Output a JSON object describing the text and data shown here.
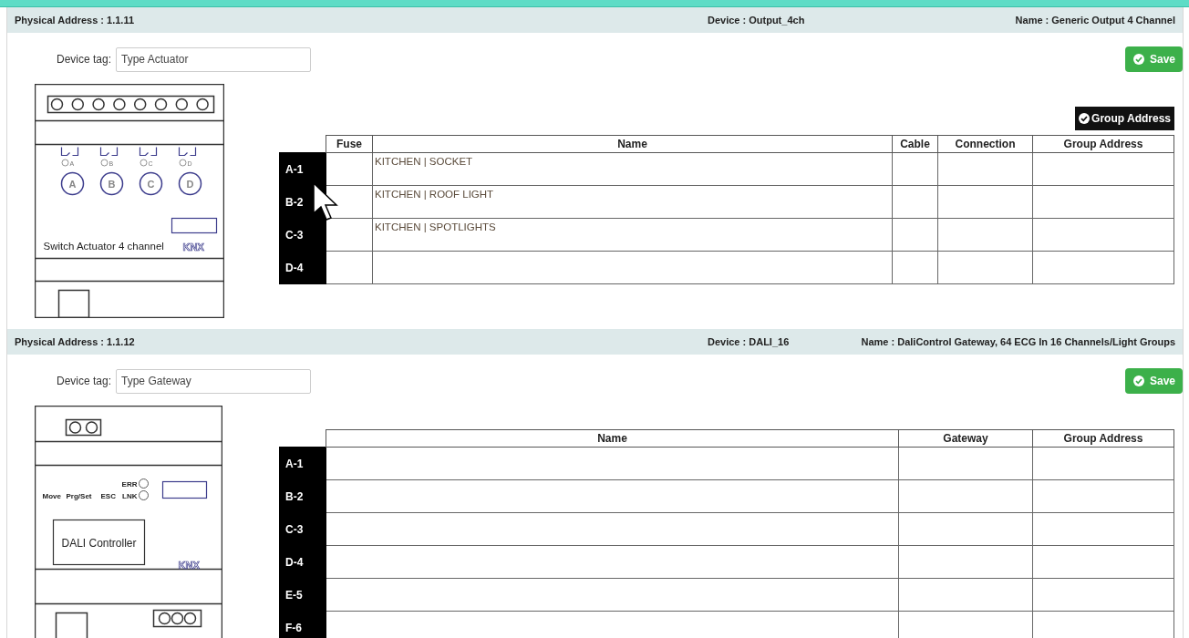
{
  "devices": [
    {
      "physical_address": "Physical Address : 1.1.11",
      "device": "Device : Output_4ch",
      "name": "Name : Generic Output 4 Channel",
      "tag_label": "Device tag:",
      "tag_value": "Type Actuator",
      "save": "Save",
      "group_address_button": "Group Address",
      "drawing": {
        "kind": "actuator",
        "channels": [
          {
            "led": "A",
            "button": "A"
          },
          {
            "led": "B",
            "button": "B"
          },
          {
            "led": "C",
            "button": "C"
          },
          {
            "led": "D",
            "button": "D"
          }
        ],
        "label": "Switch Actuator 4 channel",
        "logo": "KNX"
      },
      "table": {
        "columns": [
          {
            "title": "Fuse",
            "kind": "fuse"
          },
          {
            "title": "Name",
            "kind": "name"
          },
          {
            "title": "Cable",
            "kind": "cable"
          },
          {
            "title": "Connection",
            "kind": "connection"
          },
          {
            "title": "Group Address",
            "kind": "group"
          }
        ],
        "rows": [
          {
            "label": "A-1",
            "name": "KITCHEN | SOCKET"
          },
          {
            "label": "B-2",
            "name": "KITCHEN | ROOF LIGHT"
          },
          {
            "label": "C-3",
            "name": "KITCHEN | SPOTLIGHTS"
          },
          {
            "label": "D-4"
          }
        ]
      }
    },
    {
      "physical_address": "Physical Address : 1.1.12",
      "device": "Device : DALI_16",
      "name": "Name : DaliControl Gateway, 64 ECG In 16 Channels/Light Groups",
      "tag_label": "Device tag:",
      "tag_value": "Type Gateway",
      "save": "Save",
      "drawing": {
        "kind": "dali",
        "keys": [
          "Move",
          "Prg/Set",
          "ESC"
        ],
        "leds": [
          "ERR",
          "LNK"
        ],
        "label": "DALI Controller",
        "logo": "KNX"
      },
      "table": {
        "columns": [
          {
            "title": "Name",
            "kind": "name"
          },
          {
            "title": "Gateway",
            "kind": "gateway"
          },
          {
            "title": "Group Address",
            "kind": "group"
          }
        ],
        "rows": [
          {
            "label": "A-1"
          },
          {
            "label": "B-2"
          },
          {
            "label": "C-3"
          },
          {
            "label": "D-4"
          },
          {
            "label": "E-5"
          },
          {
            "label": "F-6"
          }
        ]
      }
    }
  ]
}
